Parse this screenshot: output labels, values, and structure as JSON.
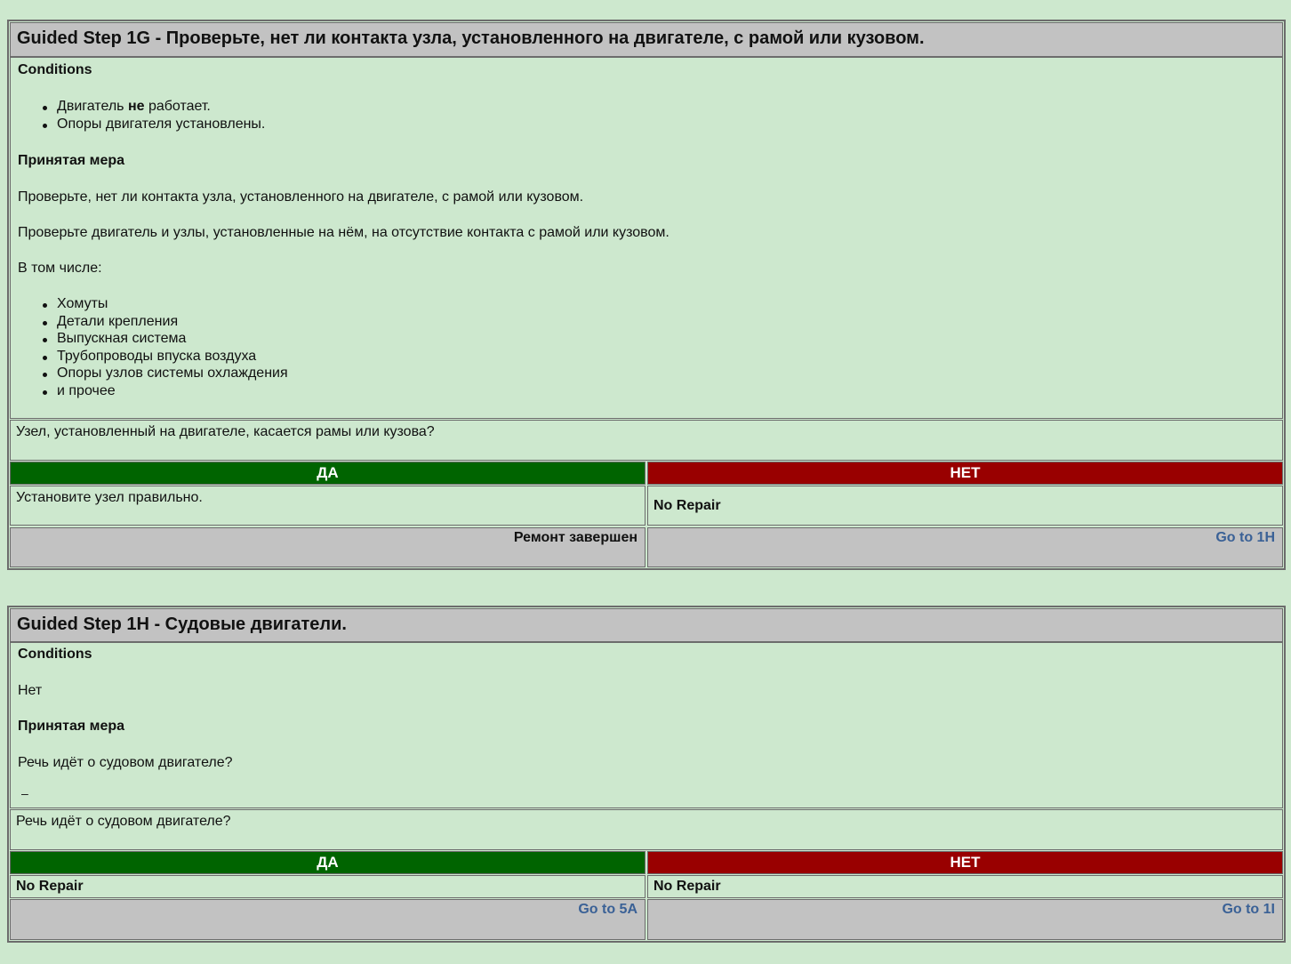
{
  "step_1g": {
    "title": "Guided Step 1G - Проверьте, нет ли контакта узла, установленного на двигателе, с рамой или кузовом.",
    "conditions_label": "Conditions",
    "condition_1_before": "Двигатель ",
    "condition_1_bold": "не",
    "condition_1_after": " работает.",
    "condition_2": "Опоры двигателя установлены.",
    "action_label": "Принятая мера",
    "action_paragraph_1": "Проверьте, нет ли контакта узла, установленного на двигателе, с рамой или кузовом.",
    "action_paragraph_2": "Проверьте двигатель и узлы, установленные на нём, на отсутствие контакта с рамой или кузовом.",
    "including_label": "В том числе:",
    "items": [
      "Хомуты",
      "Детали крепления",
      "Выпускная система",
      "Трубопроводы впуска воздуха",
      "Опоры узлов системы охлаждения",
      "и прочее"
    ],
    "question": "Узел, установленный на двигателе, касается рамы или кузова?",
    "yes_label": "ДА",
    "no_label": "НЕТ",
    "yes_result": "Установите узел правильно.",
    "no_result": "No Repair",
    "yes_action": "Ремонт завершен",
    "no_action": "Go to 1H"
  },
  "step_1h": {
    "title": "Guided Step 1H - Судовые двигатели.",
    "conditions_label": "Conditions",
    "conditions_text": "Нет",
    "action_label": "Принятая мера",
    "action_paragraph": "Речь идёт о судовом двигателе?",
    "extra_mark": "–",
    "question": "Речь идёт о судовом двигателе?",
    "yes_label": "ДА",
    "no_label": "НЕТ",
    "yes_result": "No Repair",
    "no_result": "No Repair",
    "yes_action": "Go to 5A",
    "no_action": "Go to 1I"
  },
  "colors": {
    "page_background": "#cde8ce",
    "header_gray": "#c2c2c2",
    "yes_green": "#006400",
    "no_red": "#990000",
    "link_blue": "#3a6196"
  }
}
